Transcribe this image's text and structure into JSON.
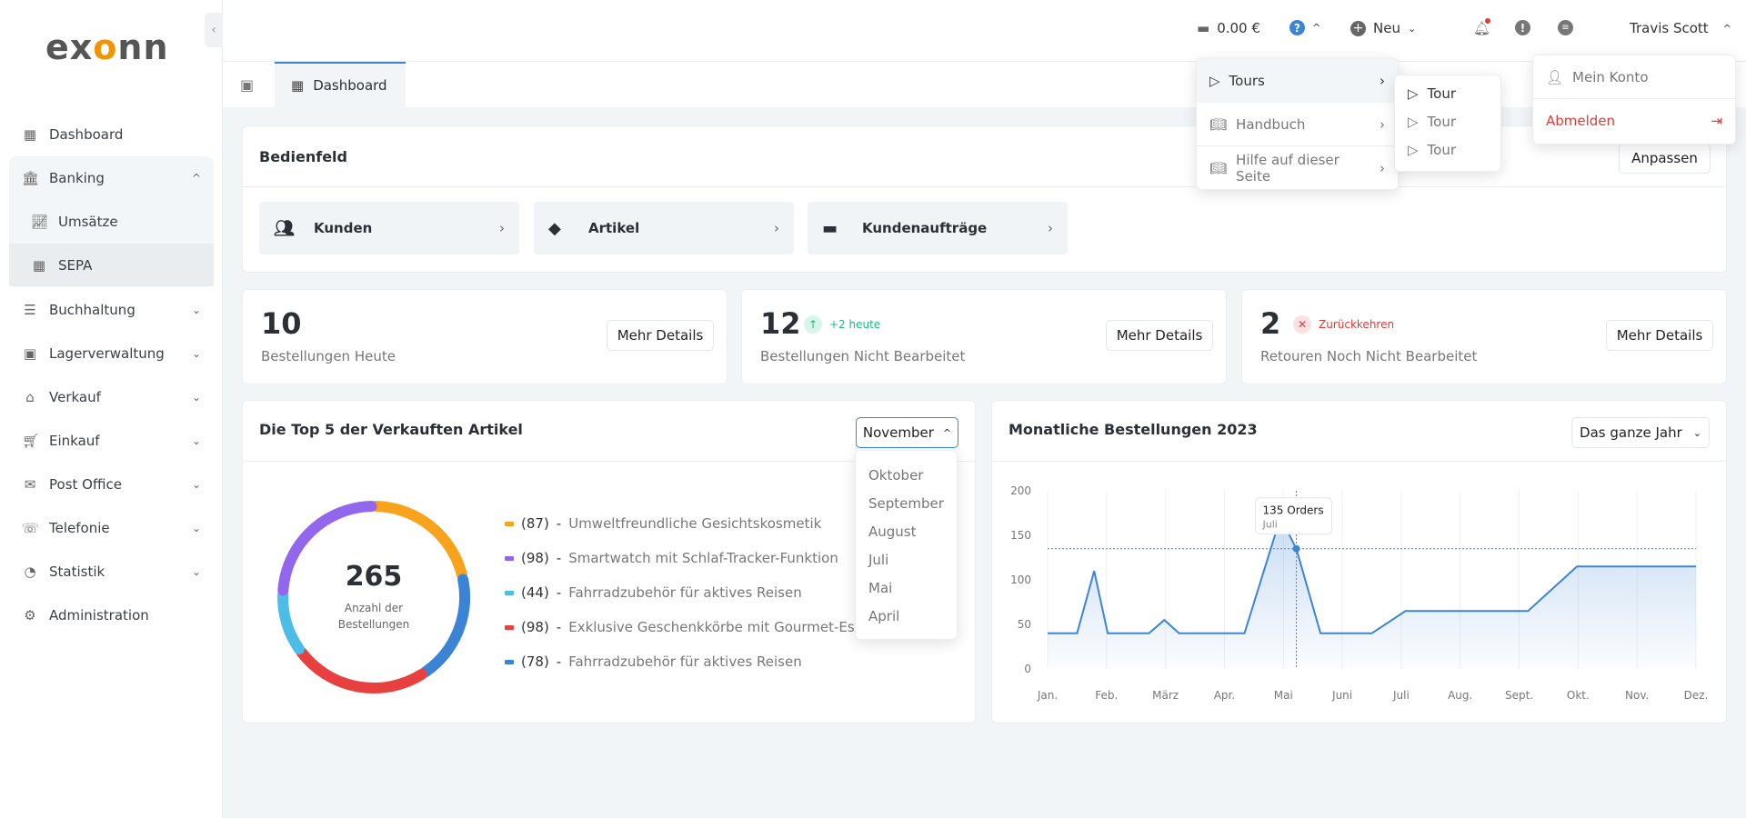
{
  "brand": {
    "logo": "exonn"
  },
  "sidebar": {
    "items": [
      {
        "label": "Dashboard",
        "icon": "grid-icon"
      },
      {
        "label": "Banking",
        "icon": "bank-icon",
        "expanded": true,
        "children": [
          {
            "label": "Umsätze",
            "icon": "chart-icon"
          },
          {
            "label": "SEPA",
            "icon": "layout-icon"
          }
        ]
      },
      {
        "label": "Buchhaltung",
        "icon": "ledger-icon"
      },
      {
        "label": "Lagerverwaltung",
        "icon": "box-icon"
      },
      {
        "label": "Verkauf",
        "icon": "store-icon"
      },
      {
        "label": "Einkauf",
        "icon": "cart-icon"
      },
      {
        "label": "Post Office",
        "icon": "mail-icon"
      },
      {
        "label": "Telefonie",
        "icon": "phone-icon"
      },
      {
        "label": "Statistik",
        "icon": "pie-icon"
      },
      {
        "label": "Administration",
        "icon": "gear-icon"
      }
    ]
  },
  "topbar": {
    "balance": "0.00 €",
    "new_label": "Neu",
    "user": "Travis Scott"
  },
  "tabs": [
    {
      "label": "Dashboard",
      "active": true
    }
  ],
  "help_menu": {
    "items": [
      {
        "label": "Tours"
      },
      {
        "label": "Handbuch"
      },
      {
        "label": "Hilfe auf dieser Seite"
      }
    ],
    "submenu": [
      "Tour",
      "Tour",
      "Tour"
    ]
  },
  "user_menu": {
    "account": "Mein Konto",
    "logout": "Abmelden"
  },
  "control_panel": {
    "title": "Bedienfeld",
    "customize": "Anpassen",
    "shortcuts": [
      {
        "label": "Kunden"
      },
      {
        "label": "Artikel"
      },
      {
        "label": "Kundenaufträge"
      }
    ]
  },
  "stats": [
    {
      "value": "10",
      "label": "Bestellungen Heute",
      "button": "Mehr Details"
    },
    {
      "value": "12",
      "badge": "+2 heute",
      "label": "Bestellungen Nicht Bearbeitet",
      "button": "Mehr Details"
    },
    {
      "value": "2",
      "badge": "Zurückkehren",
      "label": "Retouren Noch Nicht Bearbeitet",
      "button": "Mehr Details"
    }
  ],
  "top5": {
    "title": "Die Top 5 der Verkauften Artikel",
    "selected": "November",
    "options": [
      "Oktober",
      "September",
      "August",
      "Juli",
      "Mai",
      "April"
    ],
    "total": "265",
    "total_label1": "Anzahl der",
    "total_label2": "Bestellungen"
  },
  "colors": {
    "accent": "#3d84d4",
    "success": "#1eb980",
    "danger": "#e03b3b"
  },
  "chart_data": [
    {
      "type": "pie",
      "items": [
        {
          "count": "(87)",
          "label": "Umweltfreundliche Gesichtskosmetik",
          "value": 87,
          "color": "#f9a21b"
        },
        {
          "count": "(98)",
          "label": "Smartwatch mit Schlaf-Tracker-Funktion",
          "value": 98,
          "color": "#9366ee"
        },
        {
          "count": "(44)",
          "label": "Fahrradzubehör für aktives Reisen",
          "value": 44,
          "color": "#4dbde8"
        },
        {
          "count": "(98)",
          "label": "Exklusive Geschenkkörbe mit Gourmet-Essen",
          "value": 98,
          "color": "#e8403f"
        },
        {
          "count": "(78)",
          "label": "Fahrradzubehör für aktives Reisen",
          "value": 78,
          "color": "#3a83d5"
        }
      ]
    },
    {
      "type": "area",
      "title": "Monatliche Bestellungen 2023",
      "range_label": "Das ganze Jahr",
      "categories": [
        "Jan.",
        "Feb.",
        "März",
        "Apr.",
        "Mai",
        "Juni",
        "Juli",
        "Aug.",
        "Sept.",
        "Okt.",
        "Nov.",
        "Dez."
      ],
      "yticks": [
        "0",
        "50",
        "100",
        "150",
        "200"
      ],
      "ylim": [
        0,
        200
      ],
      "points": [
        [
          0,
          40
        ],
        [
          0.5,
          40
        ],
        [
          0.79,
          110
        ],
        [
          1.02,
          40
        ],
        [
          1.72,
          40
        ],
        [
          1.98,
          55
        ],
        [
          2.23,
          40
        ],
        [
          3.34,
          40
        ],
        [
          3.95,
          170
        ],
        [
          4.22,
          135
        ],
        [
          4.63,
          40
        ],
        [
          5.5,
          40
        ],
        [
          6.07,
          65
        ],
        [
          8.15,
          65
        ],
        [
          8.98,
          115
        ],
        [
          11,
          115
        ]
      ],
      "tooltip": {
        "value": "135 Orders",
        "label": "Juli",
        "x": 4.22,
        "y": 135
      },
      "color": "#3d84d4",
      "grid": true
    }
  ]
}
